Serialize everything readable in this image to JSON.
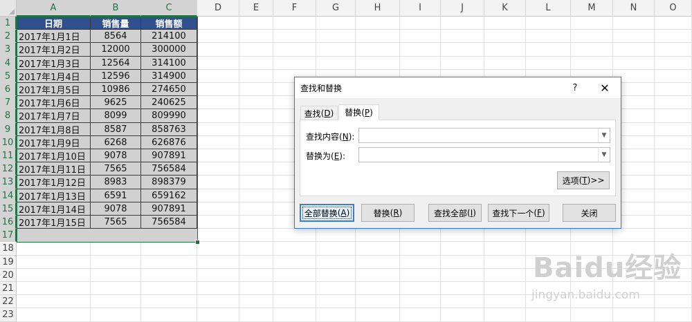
{
  "columns": [
    "A",
    "B",
    "C",
    "D",
    "E",
    "F",
    "G",
    "H",
    "I",
    "J",
    "K",
    "L",
    "M",
    "N",
    "O"
  ],
  "rows": [
    "1",
    "2",
    "3",
    "4",
    "5",
    "6",
    "7",
    "8",
    "9",
    "10",
    "11",
    "12",
    "13",
    "14",
    "15",
    "16",
    "17",
    "18",
    "19",
    "20",
    "21",
    "22",
    "23"
  ],
  "table": {
    "headers": [
      "日期",
      "销售量",
      "销售额"
    ],
    "rows": [
      [
        "2017年1月1日",
        "8564",
        "214100"
      ],
      [
        "2017年1月2日",
        "12000",
        "300000"
      ],
      [
        "2017年1月3日",
        "12564",
        "314100"
      ],
      [
        "2017年1月4日",
        "12596",
        "314900"
      ],
      [
        "2017年1月5日",
        "10986",
        "274650"
      ],
      [
        "2017年1月6日",
        "9625",
        "240625"
      ],
      [
        "2017年1月7日",
        "8099",
        "809990"
      ],
      [
        "2017年1月8日",
        "8587",
        "858763"
      ],
      [
        "2017年1月9日",
        "6268",
        "626876"
      ],
      [
        "2017年1月10日",
        "9078",
        "907891"
      ],
      [
        "2017年1月11日",
        "7565",
        "756584"
      ],
      [
        "2017年1月12日",
        "8983",
        "898379"
      ],
      [
        "2017年1月13日",
        "6591",
        "659162"
      ],
      [
        "2017年1月14日",
        "9078",
        "907891"
      ],
      [
        "2017年1月15日",
        "7565",
        "756584"
      ]
    ]
  },
  "dialog": {
    "title": "查找和替换",
    "help": "?",
    "close": "✕",
    "tab_find": "查找",
    "tab_find_key": "D",
    "tab_replace": "替换",
    "tab_replace_key": "P",
    "find_label": "查找内容",
    "find_key": "N",
    "replace_label": "替换为",
    "replace_key": "E",
    "find_value": "",
    "replace_value": "",
    "options": "选项",
    "options_key": "T",
    "options_arrows": " >>",
    "replace_all": "全部替换",
    "replace_all_key": "A",
    "replace": "替换",
    "replace_key_btn": "R",
    "find_all": "查找全部",
    "find_all_key": "I",
    "find_next": "查找下一个",
    "find_next_key": "F",
    "close_btn": "关闭"
  },
  "watermark": {
    "logo": "Baidu经验",
    "url": "jingyan.baidu.com"
  },
  "colors": {
    "header_fill": "#2f4f8f",
    "cell_fill": "#d1d1d1",
    "selection": "#217346",
    "dialog_border": "#2b79d0"
  }
}
